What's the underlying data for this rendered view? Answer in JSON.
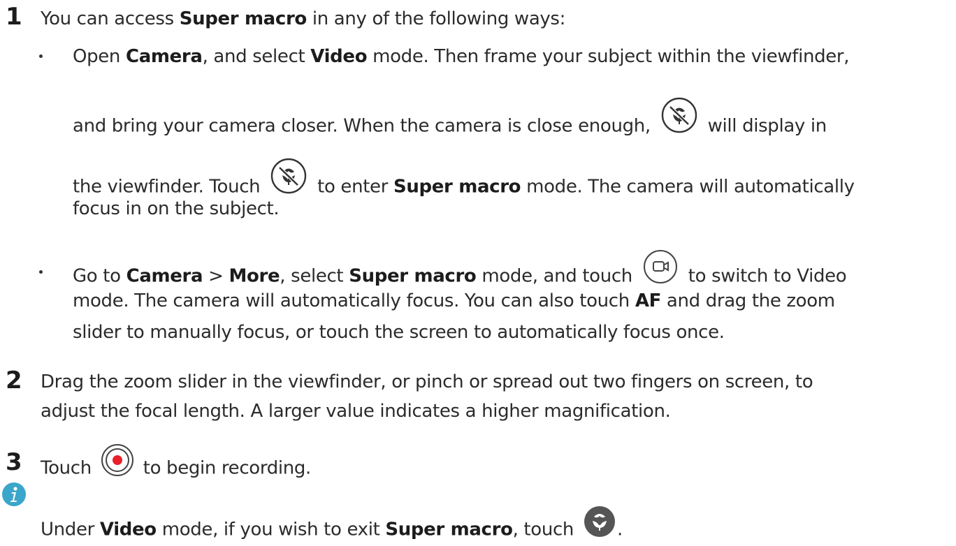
{
  "steps": [
    {
      "number": "1",
      "intro_text": "You can access",
      "intro_bold": "Super macro",
      "intro_tail": "in any of the following ways:",
      "bullets": [
        {
          "l1a": "Open",
          "l1b": "Camera",
          "l1c": ", and select",
          "l1d": "Video",
          "l1e": "mode. Then frame your subject within the viewfinder,",
          "l2a": "and bring your camera closer. When the camera is close enough,",
          "l2b": "will display in",
          "l3a": "the viewfinder. Touch",
          "l3b": "to enter",
          "l3c": "Super macro",
          "l3d": "mode. The camera will automatically",
          "l4": "focus in on the subject."
        },
        {
          "l1a": "Go to",
          "l1b": "Camera",
          "l1c": ">",
          "l1d": "More",
          "l1e": ", select",
          "l1f": "Super macro",
          "l1g": "mode, and touch",
          "l1h": "to switch to Video",
          "l2a": "mode. The camera will automatically focus. You can also touch",
          "l2b": "AF",
          "l2c": "and drag the zoom",
          "l3": "slider to manually focus, or touch the screen to automatically focus once."
        }
      ]
    },
    {
      "number": "2",
      "line1": "Drag the zoom slider in the viewfinder, or pinch or spread out two fingers on screen, to",
      "line2": "adjust the focal length. A larger value indicates a higher magnification."
    },
    {
      "number": "3",
      "text_a": "Touch",
      "text_b": "to begin recording."
    }
  ],
  "note": {
    "a": "Under",
    "b": "Video",
    "c": "mode, if you wish to exit",
    "d": "Super macro",
    "e": ", touch",
    "f": "."
  },
  "icons": {
    "macro_off": "super-macro-off-icon",
    "video_mode": "video-camera-icon",
    "record": "record-button-icon",
    "info": "info-icon",
    "macro_exit": "flower-macro-icon"
  },
  "colors": {
    "info_icon": "#3aa6c9",
    "record_dot": "#e8202a",
    "macro_exit_icon": "#555555"
  }
}
